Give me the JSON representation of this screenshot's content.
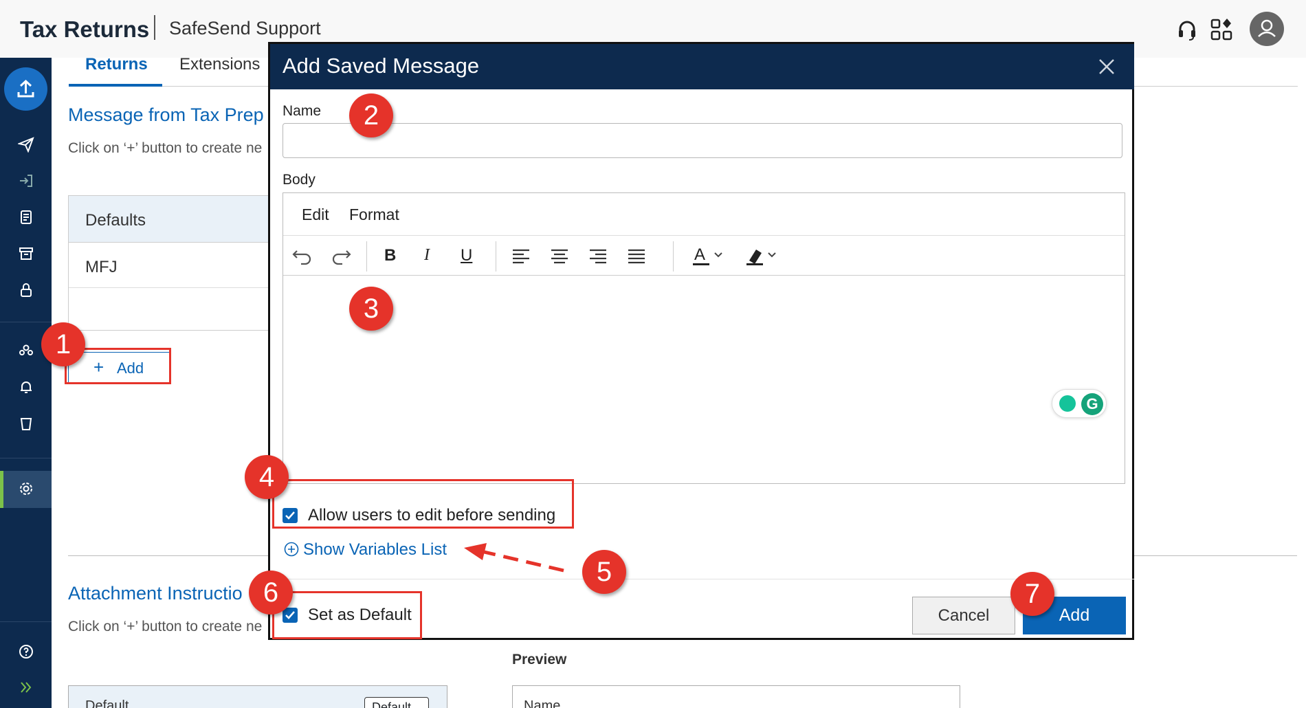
{
  "header": {
    "app_title": "Tax Returns",
    "org_name": "SafeSend Support",
    "icons": [
      "headset-icon",
      "apps-grid-icon",
      "user-avatar-icon"
    ]
  },
  "sidebar": {
    "items": [
      "upload",
      "send",
      "sign-in",
      "document",
      "archive",
      "lock",
      "users",
      "bell",
      "trash",
      "settings",
      "help",
      "expand"
    ],
    "active_item": "settings"
  },
  "tabs": {
    "returns": "Returns",
    "extensions": "Extensions"
  },
  "page": {
    "message_section_title": "Message from Tax Prep",
    "message_section_sub": "Click on ‘+’ button to create ne",
    "table_header": "Defaults",
    "table_rows": [
      "MFJ"
    ],
    "add_button": "Add",
    "attachment_section_title": "Attachment Instructio",
    "attachment_section_sub": "Click on ‘+’ button to create ne",
    "table2_cell": "Default",
    "table2_tag": "Default",
    "preview_label": "Preview",
    "preview_cell": "Name"
  },
  "modal": {
    "title": "Add Saved Message",
    "name_label": "Name",
    "name_value": "",
    "body_label": "Body",
    "menu": [
      "Edit",
      "Format"
    ],
    "toolbar": [
      "undo",
      "redo",
      "bold",
      "italic",
      "underline",
      "align-left",
      "align-center",
      "align-right",
      "justify",
      "text-color",
      "highlight-color"
    ],
    "bold_glyph": "B",
    "italic_glyph": "I",
    "underline_glyph": "U",
    "text_color_glyph": "A",
    "grammarly_glyph": "G",
    "allow_edit_label": "Allow users to edit before sending",
    "allow_edit_checked": true,
    "show_variables_label": "Show Variables List",
    "set_default_label": "Set as Default",
    "set_default_checked": true,
    "cancel_label": "Cancel",
    "add_label": "Add"
  },
  "annotations": {
    "markers": [
      "1",
      "2",
      "3",
      "4",
      "5",
      "6",
      "7"
    ],
    "color": "#e5332a"
  },
  "colors": {
    "nav": "#0d2a4e",
    "accent": "#0a64b5",
    "active_indicator": "#7cc24a"
  }
}
